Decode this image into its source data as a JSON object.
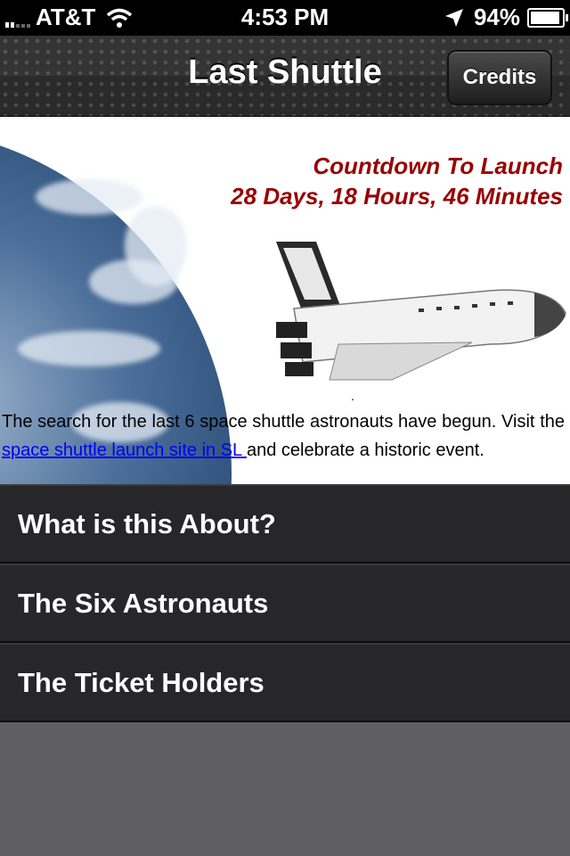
{
  "status_bar": {
    "carrier": "AT&T",
    "time": "4:53 PM",
    "battery": "94%",
    "battery_level": 0.94,
    "icons": [
      "signal-icon",
      "wifi-icon",
      "location-arrow-icon",
      "battery-icon"
    ]
  },
  "nav": {
    "title": "Last Shuttle",
    "credits_label": "Credits"
  },
  "content": {
    "countdown_title": "Countdown To Launch",
    "countdown_value": "28 Days, 18 Hours, 46 Minutes",
    "dot": ".",
    "blurb_before": "The search for the last 6 space shuttle astronauts have begun. Visit the ",
    "blurb_link": "space shuttle launch site in SL ",
    "blurb_after": "and celebrate a historic event.",
    "countdown_color": "#990000"
  },
  "menu": {
    "items": [
      {
        "label": "What is this About?"
      },
      {
        "label": "The Six Astronauts"
      },
      {
        "label": "The Ticket Holders"
      }
    ]
  }
}
